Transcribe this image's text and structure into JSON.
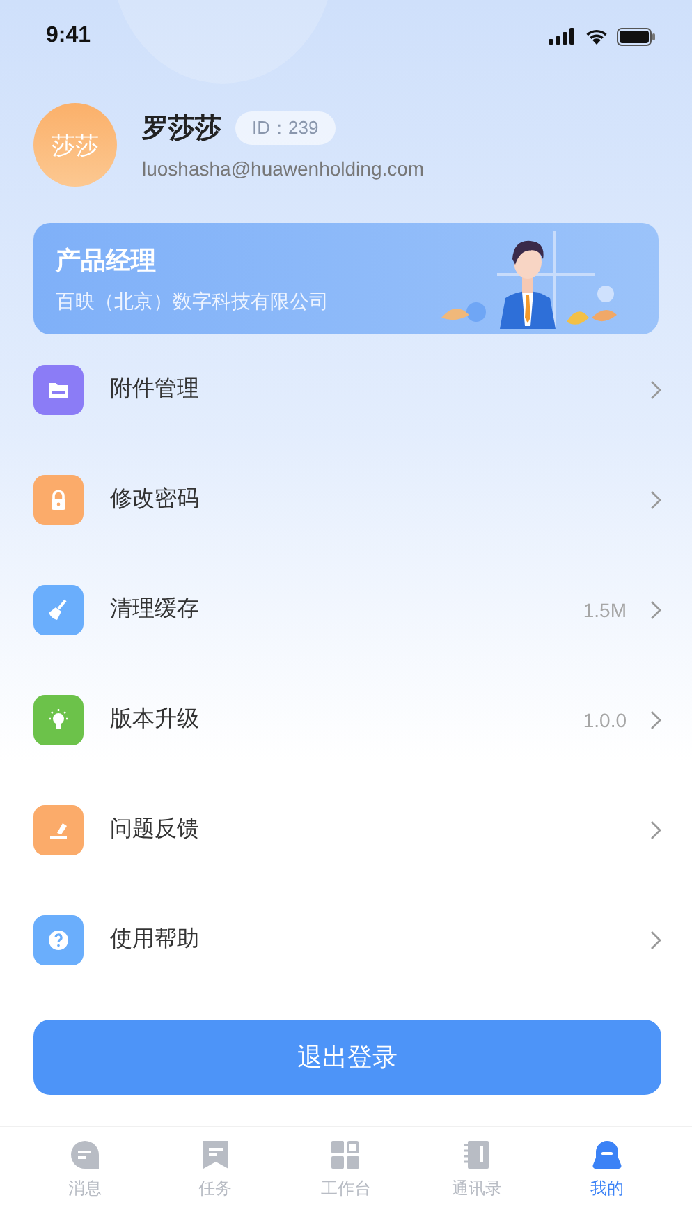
{
  "status_bar": {
    "time": "9:41"
  },
  "profile": {
    "avatar_text": "莎莎",
    "name": "罗莎莎",
    "id_badge": "ID：239",
    "email": "luoshasha@huawenholding.com"
  },
  "job_card": {
    "title": "产品经理",
    "company": "百映（北京）数字科技有限公司"
  },
  "menu": [
    {
      "kind": "folder",
      "label": "附件管理",
      "color": "#8b7cf6"
    },
    {
      "kind": "lock",
      "label": "修改密码",
      "color": "#fbab6a"
    },
    {
      "kind": "broom",
      "label": "清理缓存",
      "value": "1.5M",
      "color": "#6aaefc"
    },
    {
      "kind": "bulb",
      "label": "版本升级",
      "value": "1.0.0",
      "color": "#6cc24a"
    },
    {
      "kind": "pencil",
      "label": "问题反馈",
      "color": "#fbab6a"
    },
    {
      "kind": "help",
      "label": "使用帮助",
      "color": "#6aaefc"
    }
  ],
  "logout_button": "退出登录",
  "tab_bar": [
    {
      "kind": "chat",
      "label": "消息",
      "selected": false
    },
    {
      "kind": "task",
      "label": "任务",
      "selected": false
    },
    {
      "kind": "grid",
      "label": "工作台",
      "selected": false
    },
    {
      "kind": "book",
      "label": "通讯录",
      "selected": false
    },
    {
      "kind": "me",
      "label": "我的",
      "selected": true
    }
  ]
}
